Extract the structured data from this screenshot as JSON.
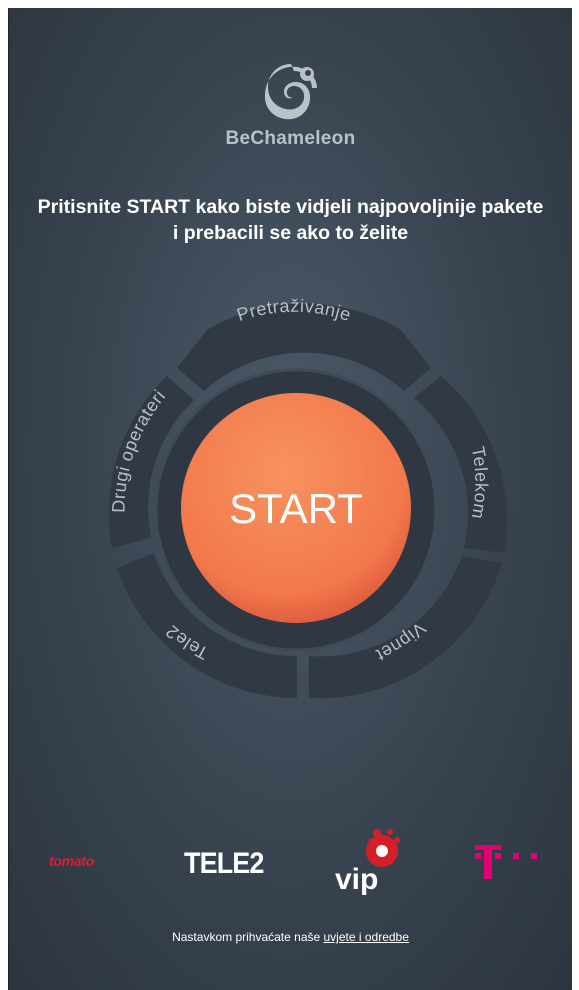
{
  "app": {
    "brand_name": "BeChameleon",
    "logo_icon": "chameleon-icon"
  },
  "headline": {
    "line1": "Pritisnite START kako biste vidjeli najpovoljnije pakete",
    "line2": "i prebacili se ako to želite"
  },
  "wheel": {
    "start_label": "START",
    "segments": {
      "top": "Pretraživanje",
      "right": "Telekom",
      "bottom_right": "Vipnet",
      "bottom_left": "Tele2",
      "left": "Drugi operateri"
    }
  },
  "operators": {
    "tomato": "tomato",
    "tele2": "TELE2",
    "vip": "vip",
    "telekom_icon": "telekom-t-logo"
  },
  "terms": {
    "prefix": "Nastavkom prihvaćate naše ",
    "link": "uvjete i odredbe"
  },
  "colors": {
    "background": "#38434f",
    "start_button": "#f2784b",
    "segment": "#313a44",
    "tomato": "#e5173a",
    "telekom": "#e20074",
    "vip": "#d51f26"
  }
}
